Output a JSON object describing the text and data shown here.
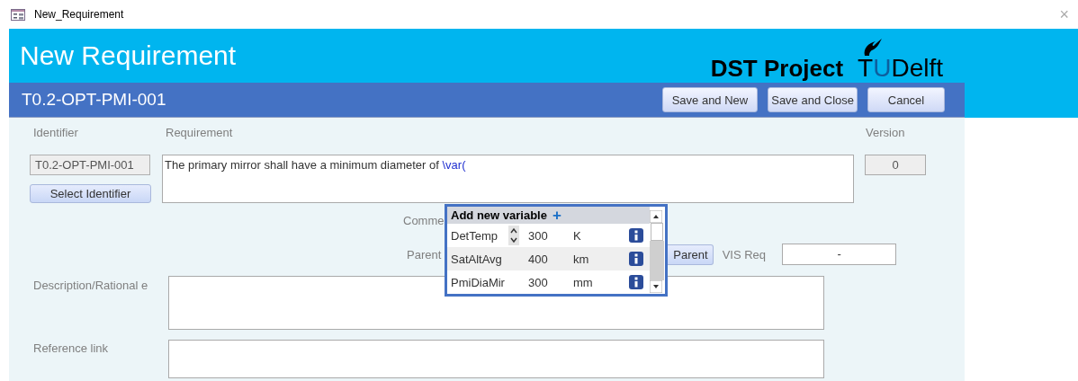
{
  "window": {
    "title": "New_Requirement",
    "close": "×"
  },
  "header": {
    "title": "New Requirement",
    "project": "DST Project",
    "logo_parts": [
      {
        "text": "T",
        "kind": "dark"
      },
      {
        "text": "U",
        "kind": "light"
      },
      {
        "text": "Delft",
        "kind": "dark"
      }
    ]
  },
  "toolbar": {
    "identifier": "T0.2-OPT-PMI-001",
    "buttons": [
      "Save and New",
      "Save and Close",
      "Cancel"
    ]
  },
  "form": {
    "identifier_label": "Identifier",
    "requirement_label": "Requirement",
    "version_label": "Version",
    "identifier_value": "T0.2-OPT-PMI-001",
    "select_button": "Select Identifier",
    "requirement_parts": [
      {
        "text": "The primary mirror shall have a minimum diameter of ",
        "kind": "plain"
      },
      {
        "text": "\\var(",
        "kind": "variable"
      }
    ],
    "version_value": "0",
    "comment_label": "Comme",
    "parent_label": "Parent",
    "parent_button": "Parent",
    "vis_label": "VIS Req",
    "vis_value": "-",
    "description_label": "Description/Rational e",
    "reference_label": "Reference link"
  },
  "popup": {
    "title": "Add new variable",
    "add": "+",
    "rows": [
      {
        "name": "DetTemp",
        "value": "300",
        "unit": "K",
        "focused": true
      },
      {
        "name": "SatAltAvg",
        "value": "400",
        "unit": "km",
        "focused": false
      },
      {
        "name": "PmiDiaMir",
        "value": "300",
        "unit": "mm",
        "focused": false
      }
    ]
  }
}
